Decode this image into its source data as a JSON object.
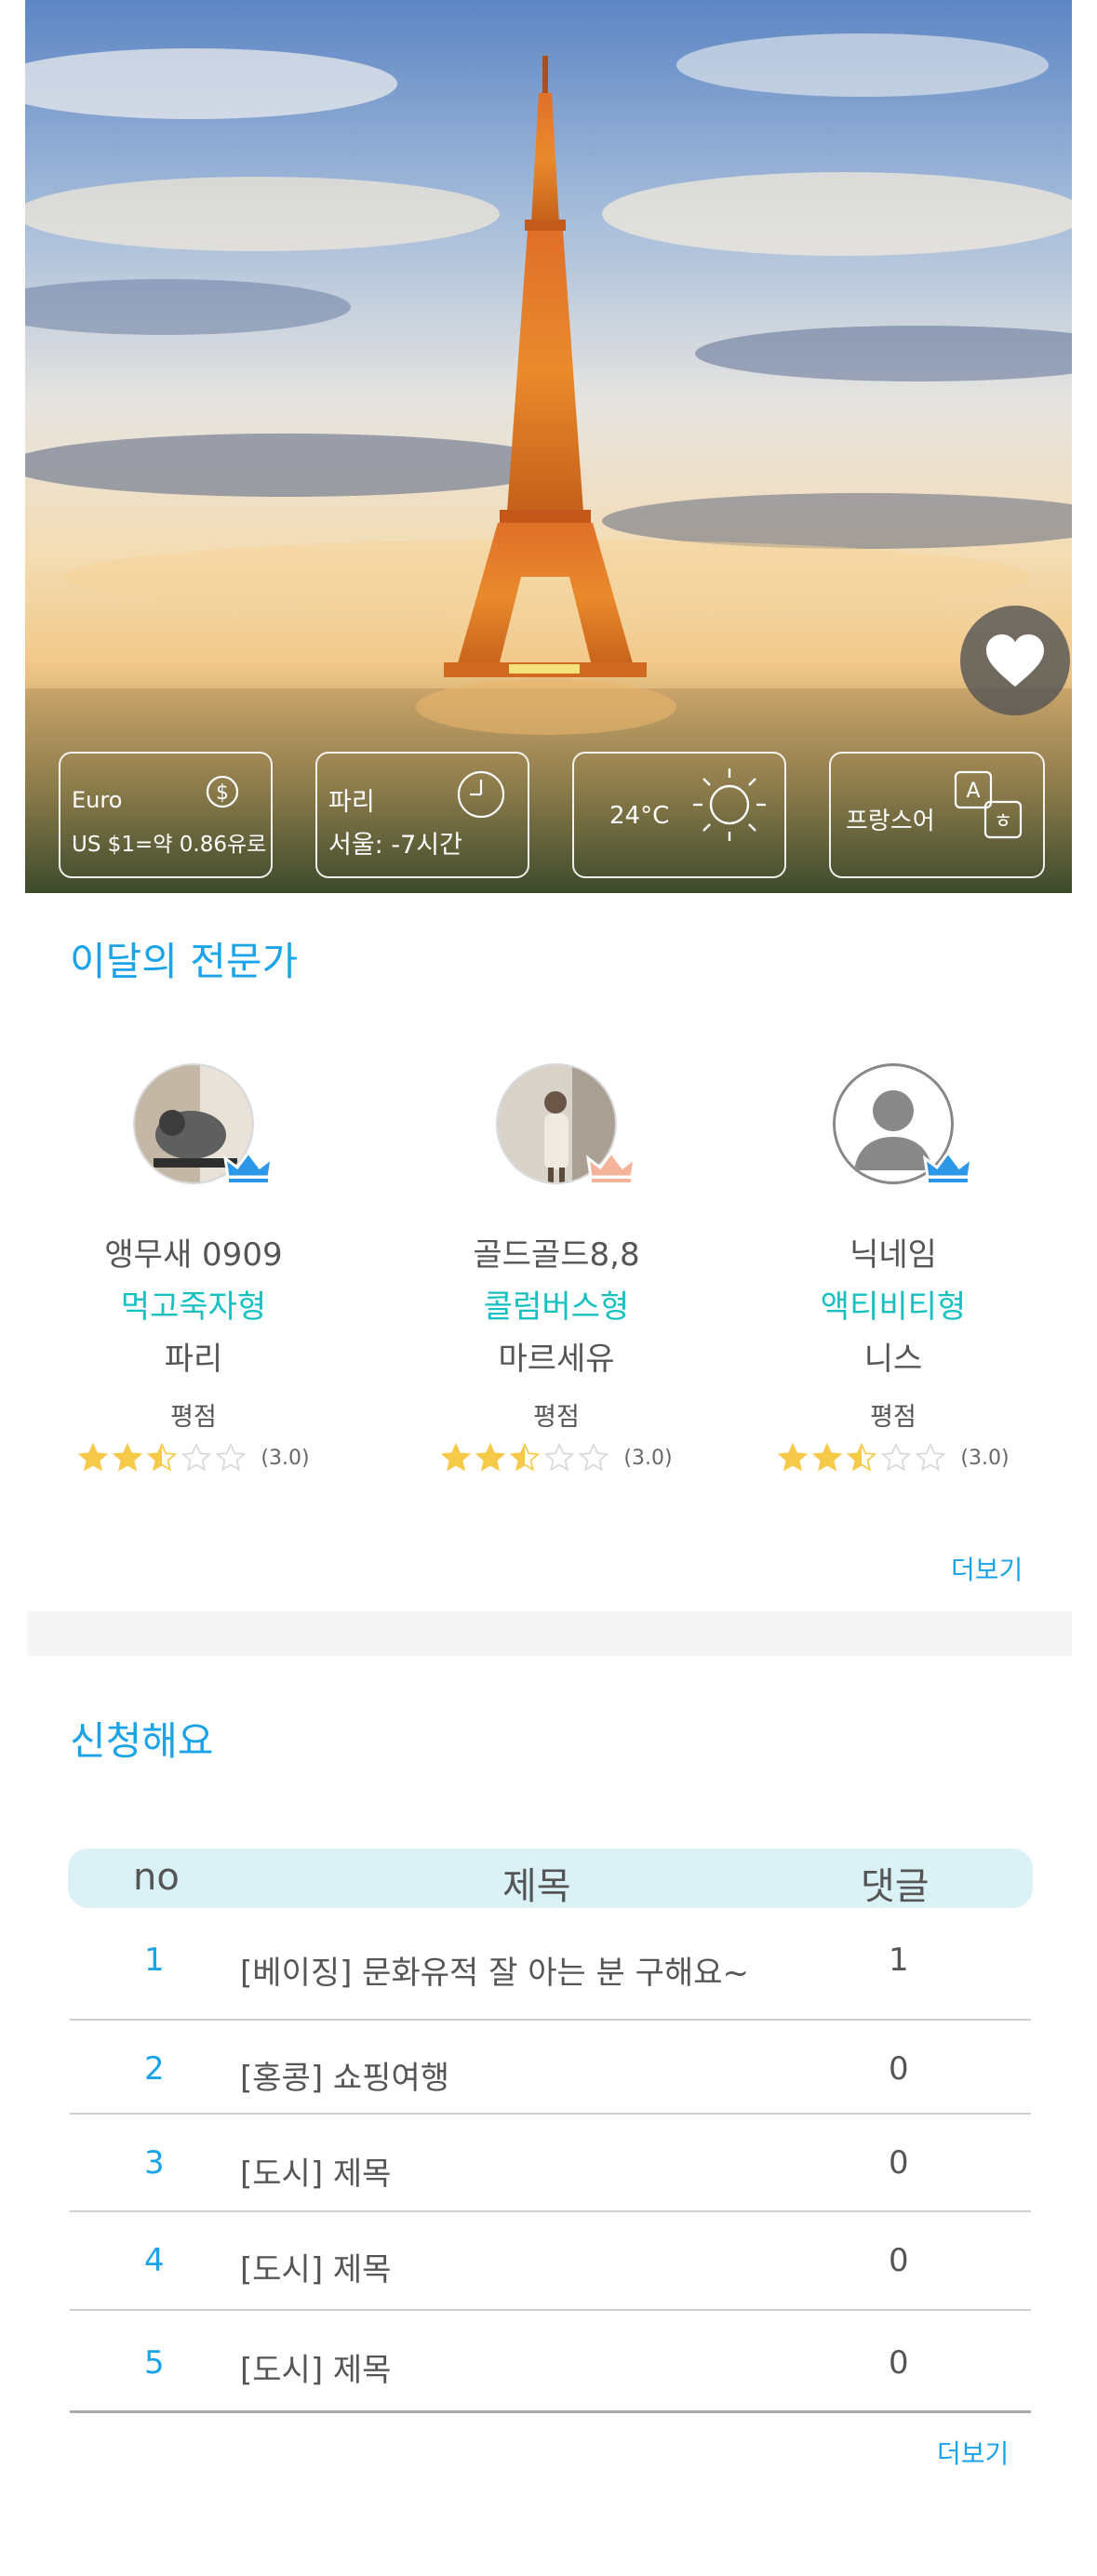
{
  "hero": {
    "currency": {
      "label": "Euro",
      "rate": "US $1=약 0.86유로",
      "icon": "dollar-icon"
    },
    "time": {
      "city": "파리",
      "diff": "서울: -7시간",
      "icon": "clock-icon"
    },
    "weather": {
      "temp": "24°C",
      "icon": "sun-icon"
    },
    "language": {
      "label": "프랑스어",
      "icon": "translate-icon"
    },
    "favorite_icon": "heart-icon"
  },
  "experts": {
    "title": "이달의 전문가",
    "rating_label": "평점",
    "more": "더보기",
    "items": [
      {
        "name": "앵무새 0909",
        "type": "먹고죽자형",
        "city": "파리",
        "rating": 2.5,
        "rating_text": "(3.0)",
        "crown_color": "#2b97e6"
      },
      {
        "name": "골드골드8,8",
        "type": "콜럼버스형",
        "city": "마르세유",
        "rating": 2.5,
        "rating_text": "(3.0)",
        "crown_color": "#f5b49a"
      },
      {
        "name": "닉네임",
        "type": "액티비티형",
        "city": "니스",
        "rating": 2.5,
        "rating_text": "(3.0)",
        "crown_color": "#2b97e6"
      }
    ]
  },
  "requests": {
    "title": "신청해요",
    "more": "더보기",
    "columns": {
      "no": "no",
      "title": "제목",
      "comments": "댓글"
    },
    "rows": [
      {
        "no": "1",
        "title": "[베이징]  문화유적 잘 아는 분 구해요~",
        "comments": "1"
      },
      {
        "no": "2",
        "title": "[홍콩] 쇼핑여행",
        "comments": "0"
      },
      {
        "no": "3",
        "title": "[도시] 제목",
        "comments": "0"
      },
      {
        "no": "4",
        "title": "[도시] 제목",
        "comments": "0"
      },
      {
        "no": "5",
        "title": "[도시] 제목",
        "comments": "0"
      }
    ]
  },
  "colors": {
    "accent": "#1aa3e8",
    "teal": "#16c0c0",
    "star": "#f7c948"
  }
}
